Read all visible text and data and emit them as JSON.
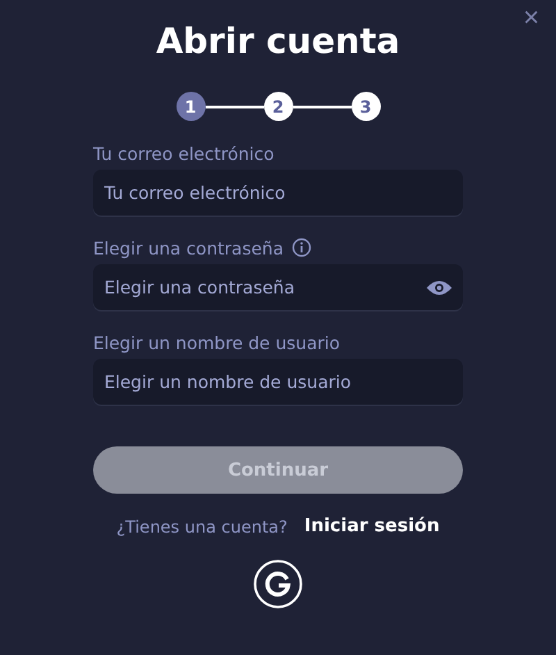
{
  "dialog": {
    "title": "Abrir cuenta",
    "close": "×"
  },
  "steps": [
    {
      "label": "1",
      "selected": true
    },
    {
      "label": "2",
      "selected": false
    },
    {
      "label": "3",
      "selected": false
    }
  ],
  "fields": [
    {
      "kind": "text",
      "label": "Tu correo electrónico",
      "placeholder": "Tu correo electrónico",
      "info": false
    },
    {
      "kind": "password",
      "label": "Elegir una contraseña",
      "placeholder": "Elegir una contraseña",
      "info": true
    },
    {
      "kind": "text",
      "label": "Elegir un nombre de usuario",
      "placeholder": "Elegir un nombre de usuario",
      "info": false
    }
  ],
  "submit": {
    "label": "Continuar",
    "disabled": true
  },
  "login": {
    "prompt": "¿Tienes una cuenta?",
    "link": "Iniciar sesión"
  }
}
